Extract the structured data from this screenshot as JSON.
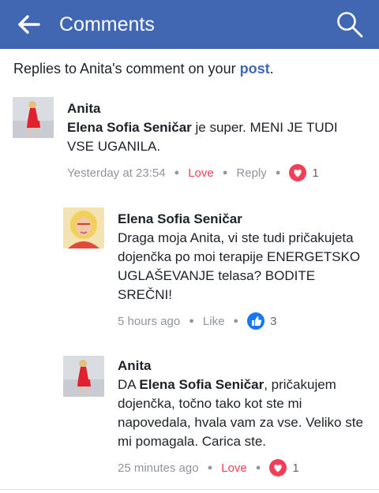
{
  "header": {
    "title": "Comments",
    "background": "#4267b2"
  },
  "subheader": {
    "prefix": "Replies to Anita's comment on your ",
    "link": "post",
    "suffix": "."
  },
  "comments": [
    {
      "author": "Anita",
      "mention": "Elena Sofia Seničar",
      "text": " je super. MENI JE TUDI VSE UGANILA.",
      "time": "Yesterday at 23:54",
      "action": "Love",
      "reply": "Reply",
      "reaction_icon": "love-icon",
      "reaction_count": "1"
    },
    {
      "author": "Elena Sofia Seničar",
      "text": "Draga moja Anita, vi ste tudi pričakujeta dojenčka po moi terapije ENERGETSKO UGLAŠEVANJE telasa? BODITE SREČNI!",
      "time": "5 hours ago",
      "action": "Like",
      "reaction_icon": "like-icon",
      "reaction_count": "3"
    },
    {
      "author": "Anita",
      "prefix": "DA ",
      "mention": "Elena Sofia Seničar",
      "text": ", pričakujem dojenčka, točno tako kot ste mi napovedala, hvala vam za vse. Veliko ste mi pomagala. Carica ste.",
      "time": "25 minutes ago",
      "action": "Love",
      "reaction_icon": "love-icon",
      "reaction_count": "1"
    }
  ],
  "colors": {
    "link": "#4267b2",
    "love": "#f33e58",
    "like": "#1877f2",
    "meta": "#90949c"
  }
}
